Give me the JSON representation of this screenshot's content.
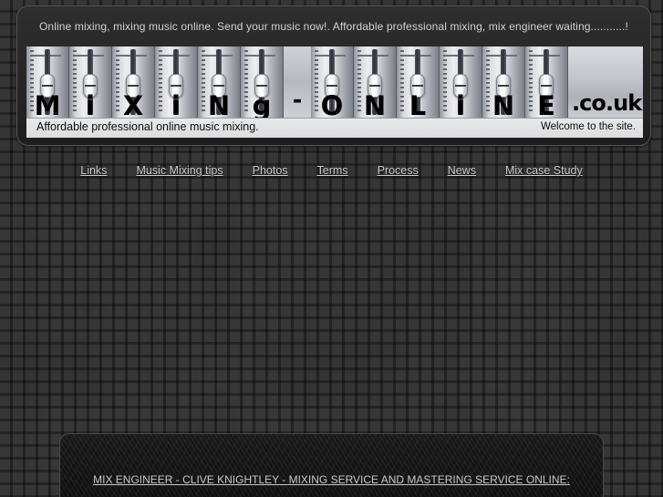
{
  "header": {
    "tagline": "Online mixing, mixing music online. Send your music now!. Affordable professional mixing, mix engineer waiting...........!"
  },
  "banner": {
    "channels": [
      {
        "letter": "M",
        "knob_position": "mid"
      },
      {
        "letter": "i",
        "knob_position": "mid"
      },
      {
        "letter": "X",
        "knob_position": "mid"
      },
      {
        "letter": "i",
        "knob_position": "mid"
      },
      {
        "letter": "N",
        "knob_position": "mid"
      },
      {
        "letter": "g",
        "knob_position": "mid"
      }
    ],
    "separator": "-",
    "channels2": [
      {
        "letter": "O",
        "knob_position": "mid"
      },
      {
        "letter": "N",
        "knob_position": "mid"
      },
      {
        "letter": "L",
        "knob_position": "mid"
      },
      {
        "letter": "i",
        "knob_position": "mid"
      },
      {
        "letter": "N",
        "knob_position": "mid"
      },
      {
        "letter": "E",
        "knob_position": "mid"
      }
    ],
    "tld": ".co.uk",
    "strip_left": "Affordable professional online music mixing.",
    "strip_right": "Welcome to the site."
  },
  "nav": {
    "items": [
      {
        "label": "Links"
      },
      {
        "label": "Music Mixing tips"
      },
      {
        "label": "Photos"
      },
      {
        "label": "Terms"
      },
      {
        "label": "Process"
      },
      {
        "label": "News"
      },
      {
        "label": "Mix case Study"
      }
    ]
  },
  "content": {
    "heading": "MIX ENGINEER - CLIVE KNIGHTLEY - MIXING SERVICE AND MASTERING SERVICE ONLINE:"
  },
  "colors": {
    "page_background": "#2b2b2b",
    "panel_background": "#262626",
    "link_text": "#cdcdcd",
    "banner_metal_light": "#eceef0",
    "banner_metal_dark": "#7b7e86"
  }
}
